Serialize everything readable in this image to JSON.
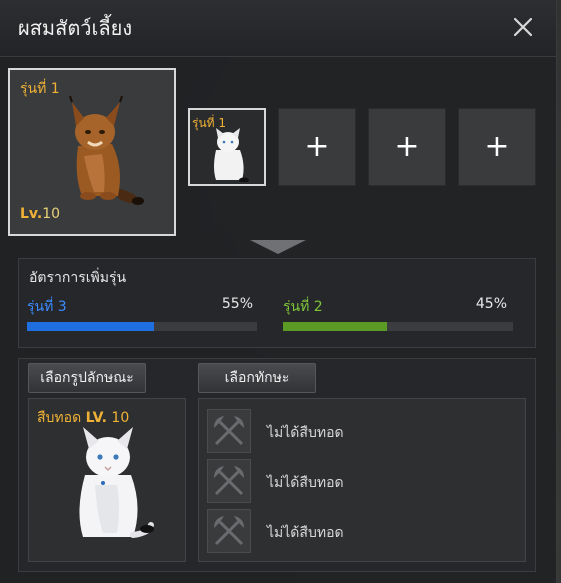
{
  "window": {
    "title": "ผสมสัตว์เลี้ยง"
  },
  "main_pet": {
    "generation": "รุ่นที่ 1",
    "level_prefix": "Lv.",
    "level_value": "10"
  },
  "material_slots": [
    {
      "generation": "รุ่นที่ 1",
      "filled": true
    },
    {
      "symbol": "+",
      "filled": false
    },
    {
      "symbol": "+",
      "filled": false
    },
    {
      "symbol": "+",
      "filled": false
    }
  ],
  "rate_panel": {
    "title": "อัตราการเพิ่มรุ่น",
    "options": [
      {
        "label": "รุ่นที่ 3",
        "percent_text": "55%",
        "fraction": 0.55,
        "color": "#1f6fe0",
        "label_color": "#3b8cff"
      },
      {
        "label": "รุ่นที่ 2",
        "percent_text": "45%",
        "fraction": 0.45,
        "color": "#5a9a25",
        "label_color": "#7ec63a"
      }
    ]
  },
  "buttons": {
    "select_appearance": "เลือกรูปลักษณะ",
    "select_skill": "เลือกทักษะ"
  },
  "inheritance": {
    "label": "สืบทอด",
    "level_label": "LV.",
    "level_value": "10"
  },
  "skills": [
    {
      "status": "ไม่ได้สืบทอด",
      "icon": "crossed-axes-icon"
    },
    {
      "status": "ไม่ได้สืบทอด",
      "icon": "crossed-axes-icon"
    },
    {
      "status": "ไม่ได้สืบทอด",
      "icon": "crossed-axes-icon"
    }
  ]
}
